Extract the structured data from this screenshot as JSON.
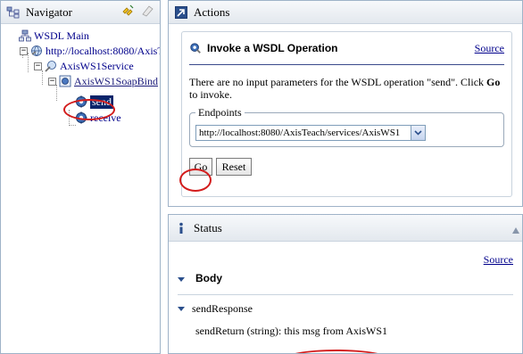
{
  "navigator": {
    "title": "Navigator",
    "tree": [
      {
        "label": "WSDL Main"
      },
      {
        "label": "http://localhost:8080/AxisT"
      },
      {
        "label": "AxisWS1Service"
      },
      {
        "label": "AxisWS1SoapBind"
      },
      {
        "label": "send",
        "selected": true
      },
      {
        "label": "receive"
      }
    ]
  },
  "actions": {
    "title": "Actions",
    "operation_title": "Invoke a WSDL Operation",
    "source_label": "Source",
    "message_part1": "There are no input parameters for the WSDL operation \"send\". Click ",
    "message_bold": "Go",
    "message_part2": " to invoke.",
    "endpoints_legend": "Endpoints",
    "endpoint_value": "http://localhost:8080/AxisTeach/services/AxisWS1",
    "go_label": "Go",
    "reset_label": "Reset"
  },
  "status": {
    "title": "Status",
    "source_label": "Source",
    "body_label": "Body",
    "response_label": "sendResponse",
    "return_label": "sendReturn (string):",
    "return_value": "this msg from AxisWS1"
  },
  "colors": {
    "header_bg": "#e3e8ee",
    "link": "#00008b",
    "selection": "#0a246a",
    "highlight_ring": "#d31c1c"
  }
}
